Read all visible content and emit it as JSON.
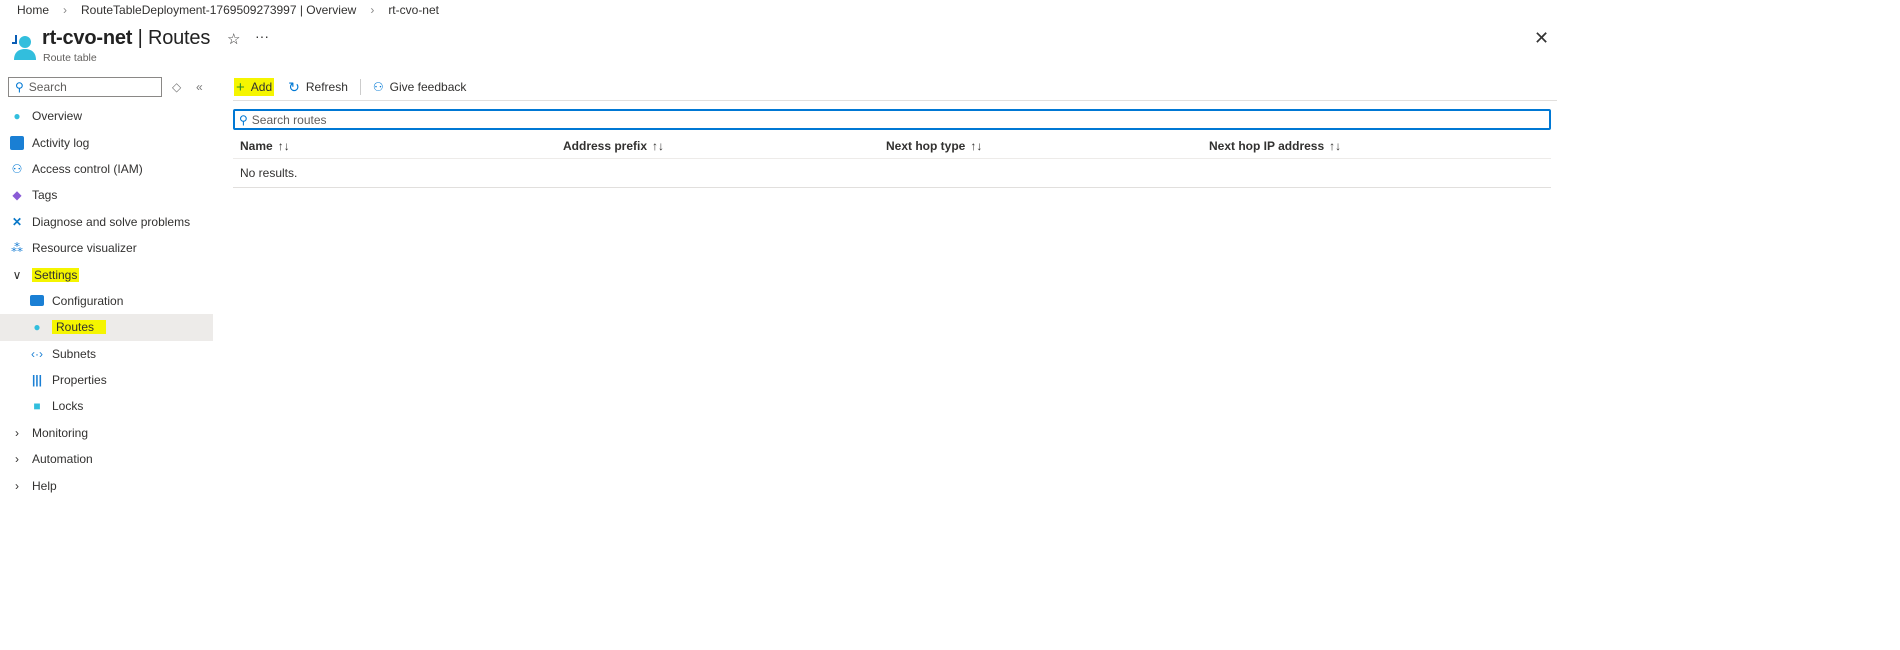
{
  "breadcrumb": [
    "Home",
    "RouteTableDeployment-1769509273997 | Overview",
    "rt-cvo-net"
  ],
  "header": {
    "resource": "rt-cvo-net",
    "page": "Routes",
    "separator": "|",
    "subtitle": "Route table",
    "star": "☆",
    "more": "···",
    "close": "✕"
  },
  "sidebar": {
    "search_placeholder": "Search",
    "items": [
      {
        "label": "Overview",
        "icon": "route-table-icon"
      },
      {
        "label": "Activity log",
        "icon": "activity-log-icon"
      },
      {
        "label": "Access control (IAM)",
        "icon": "iam-icon"
      },
      {
        "label": "Tags",
        "icon": "tag-icon"
      },
      {
        "label": "Diagnose and solve problems",
        "icon": "wrench-icon"
      },
      {
        "label": "Resource visualizer",
        "icon": "visualizer-icon"
      }
    ],
    "settings": {
      "label": "Settings",
      "items": [
        {
          "label": "Configuration",
          "icon": "configuration-icon"
        },
        {
          "label": "Routes",
          "icon": "route-table-icon"
        },
        {
          "label": "Subnets",
          "icon": "subnet-icon"
        },
        {
          "label": "Properties",
          "icon": "properties-icon"
        },
        {
          "label": "Locks",
          "icon": "lock-icon"
        }
      ]
    },
    "groups": [
      "Monitoring",
      "Automation",
      "Help"
    ]
  },
  "toolbar": {
    "add": "Add",
    "refresh": "Refresh",
    "feedback": "Give feedback"
  },
  "main": {
    "search_placeholder": "Search routes",
    "columns": [
      "Name",
      "Address prefix",
      "Next hop type",
      "Next hop IP address"
    ],
    "sort_glyph": "↑↓",
    "empty": "No results."
  },
  "colors": {
    "accent": "#0078d4",
    "highlight": "#f5f500",
    "selected": "#edebe9"
  }
}
